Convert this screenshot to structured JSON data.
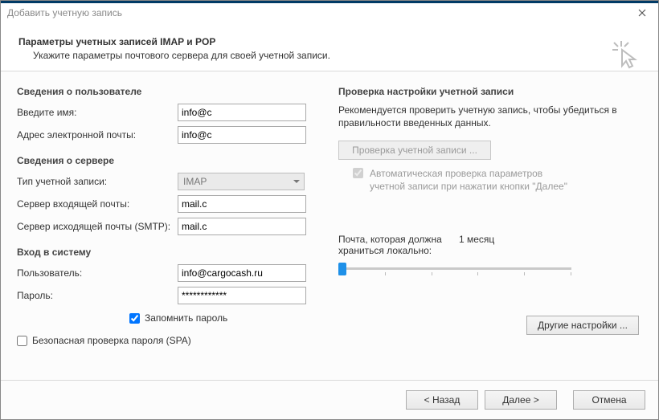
{
  "window": {
    "title": "Добавить учетную запись"
  },
  "header": {
    "title": "Параметры учетных записей IMAP и POP",
    "subtitle": "Укажите параметры почтового сервера для своей учетной записи."
  },
  "left": {
    "user_section": "Сведения о пользователе",
    "name_label": "Введите имя:",
    "name_value": "info@c",
    "email_label": "Адрес электронной почты:",
    "email_value": "info@c",
    "server_section": "Сведения о сервере",
    "account_type_label": "Тип учетной записи:",
    "account_type_value": "IMAP",
    "incoming_label": "Сервер входящей почты:",
    "incoming_value": "mail.c",
    "outgoing_label": "Сервер исходящей почты (SMTP):",
    "outgoing_value": "mail.c",
    "login_section": "Вход в систему",
    "user_label": "Пользователь:",
    "user_value": "info@cargocash.ru",
    "password_label": "Пароль:",
    "password_value": "************",
    "remember": "Запомнить пароль",
    "spa": "Безопасная проверка пароля (SPA)"
  },
  "right": {
    "test_section": "Проверка настройки учетной записи",
    "recommend": "Рекомендуется проверить учетную запись, чтобы убедиться в правильности введенных данных.",
    "test_button": "Проверка учетной записи ...",
    "auto_test": "Автоматическая проверка параметров учетной записи при нажатии кнопки \"Далее\"",
    "keep_label": "Почта, которая должна храниться локально:",
    "keep_value": "1 месяц",
    "more_settings": "Другие настройки ..."
  },
  "footer": {
    "back": "< Назад",
    "next": "Далее >",
    "cancel": "Отмена"
  }
}
